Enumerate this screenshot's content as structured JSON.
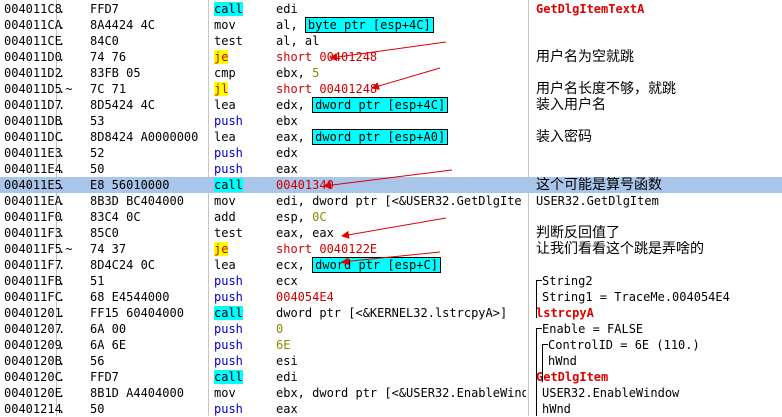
{
  "rows": [
    {
      "addr": "004011C8",
      "dot": ".",
      "hex": "FFD7",
      "mnem": "call",
      "ops": "edi",
      "comment": "GetDlgItemTextA"
    },
    {
      "addr": "004011CA",
      "dot": ".",
      "hex": "8A4424 4C",
      "mnem": "mov",
      "ops_pre": "al, ",
      "ops_box": "byte ptr [esp+4C]",
      "comment": ""
    },
    {
      "addr": "004011CE",
      "dot": ".",
      "hex": "84C0",
      "mnem": "test",
      "ops": "al, al",
      "comment": ""
    },
    {
      "addr": "004011D0",
      "dot": ".",
      "hex": "74 76",
      "mnem": "je",
      "ops": "short 00401248",
      "comment": "用户名为空就跳"
    },
    {
      "addr": "004011D2",
      "dot": ".",
      "hex": "83FB 05",
      "mnem": "cmp",
      "ops_pre": "ebx, ",
      "ops_num": "5",
      "comment": ""
    },
    {
      "addr": "004011D5",
      "dot": ".~",
      "hex": "7C 71",
      "mnem": "jl",
      "ops": "short 00401248",
      "comment": "用户名长度不够，就跳"
    },
    {
      "addr": "004011D7",
      "dot": ".",
      "hex": "8D5424 4C",
      "mnem": "lea",
      "ops_pre": "edx, ",
      "ops_box": "dword ptr [esp+4C]",
      "comment": "装入用户名"
    },
    {
      "addr": "004011DB",
      "dot": ".",
      "hex": "53",
      "mnem": "push",
      "ops": "ebx",
      "comment": ""
    },
    {
      "addr": "004011DC",
      "dot": ".",
      "hex": "8D8424 A0000000",
      "mnem": "lea",
      "ops_pre": "eax, ",
      "ops_box": "dword ptr [esp+A0]",
      "comment": "装入密码"
    },
    {
      "addr": "004011E3",
      "dot": ".",
      "hex": "52",
      "mnem": "push",
      "ops": "edx",
      "comment": ""
    },
    {
      "addr": "004011E4",
      "dot": ".",
      "hex": "50",
      "mnem": "push",
      "ops": "eax",
      "comment": ""
    },
    {
      "addr": "004011E5",
      "dot": ".",
      "hex": "E8 56010000",
      "mnem": "call",
      "ops": "00401340",
      "comment": "这个可能是算号函数"
    },
    {
      "addr": "004011EA",
      "dot": ".",
      "hex": "8B3D BC404000",
      "mnem": "mov",
      "ops": "edi, dword ptr [<&USER32.GetDlgIte",
      "comment": "USER32.GetDlgItem"
    },
    {
      "addr": "004011F0",
      "dot": ".",
      "hex": "83C4 0C",
      "mnem": "add",
      "ops_pre": "esp, ",
      "ops_num": "0C",
      "comment": ""
    },
    {
      "addr": "004011F3",
      "dot": ".",
      "hex": "85C0",
      "mnem": "test",
      "ops": "eax, eax",
      "comment": "判断反回值了"
    },
    {
      "addr": "004011F5",
      "dot": ".~",
      "hex": "74 37",
      "mnem": "je",
      "ops": "short 0040122E",
      "comment": "让我们看看这个跳是弄啥的"
    },
    {
      "addr": "004011F7",
      "dot": ".",
      "hex": "8D4C24 0C",
      "mnem": "lea",
      "ops_pre": "ecx, ",
      "ops_box": "dword ptr [esp+C]",
      "comment": ""
    },
    {
      "addr": "004011FB",
      "dot": ".",
      "hex": "51",
      "mnem": "push",
      "ops": "ecx",
      "comment": "String2"
    },
    {
      "addr": "004011FC",
      "dot": ".",
      "hex": "68 E4544000",
      "mnem": "push",
      "ops": "004054E4",
      "comment": "String1 = TraceMe.004054E4"
    },
    {
      "addr": "00401201",
      "dot": ".",
      "hex": "FF15 60404000",
      "mnem": "call",
      "ops": "dword ptr [<&KERNEL32.lstrcpyA>]",
      "comment": "lstrcpyA"
    },
    {
      "addr": "00401207",
      "dot": ".",
      "hex": "6A 00",
      "mnem": "push",
      "ops_num": "0",
      "comment": "Enable = FALSE"
    },
    {
      "addr": "00401209",
      "dot": ".",
      "hex": "6A 6E",
      "mnem": "push",
      "ops_num": "6E",
      "comment": "ControlID = 6E (110.)"
    },
    {
      "addr": "0040120B",
      "dot": ".",
      "hex": "56",
      "mnem": "push",
      "ops": "esi",
      "comment": "hWnd"
    },
    {
      "addr": "0040120C",
      "dot": ".",
      "hex": "FFD7",
      "mnem": "call",
      "ops": "edi",
      "comment": "GetDlgItem"
    },
    {
      "addr": "0040120E",
      "dot": ".",
      "hex": "8B1D A4404000",
      "mnem": "mov",
      "ops": "ebx, dword ptr [<&USER32.EnableWind",
      "comment": "USER32.EnableWindow"
    },
    {
      "addr": "00401214",
      "dot": ".",
      "hex": "50",
      "mnem": "push",
      "ops": "eax",
      "comment": "hWnd"
    }
  ],
  "colors": {
    "selected": "#a9c6ea",
    "call": "#00ffff",
    "jump": "#ffff00",
    "arrow": "#e00000"
  }
}
